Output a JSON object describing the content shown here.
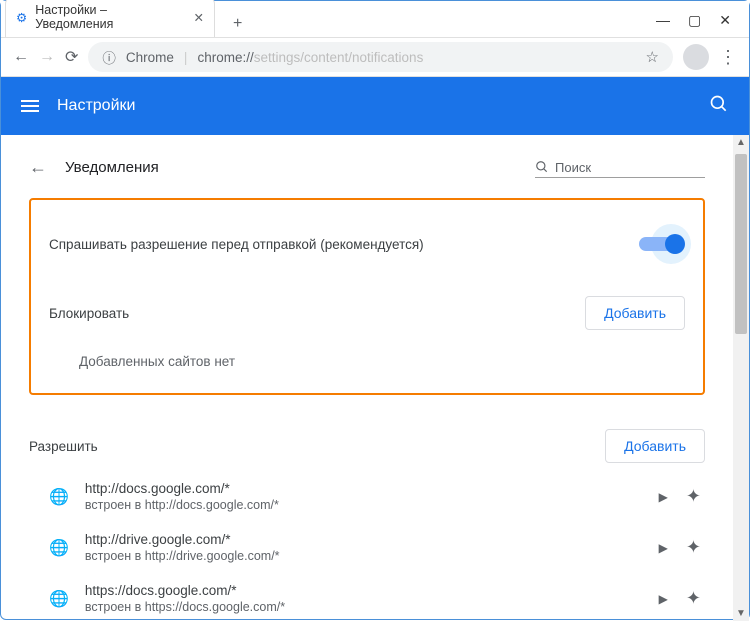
{
  "window": {
    "tab_title": "Настройки – Уведомления"
  },
  "toolbar": {
    "chrome_label": "Chrome",
    "url_host": "chrome://",
    "url_path": "settings/content/notifications"
  },
  "header": {
    "title": "Настройки"
  },
  "page": {
    "title": "Уведомления",
    "search_placeholder": "Поиск"
  },
  "toggle": {
    "label": "Спрашивать разрешение перед отправкой (рекомендуется)"
  },
  "block_section": {
    "label": "Блокировать",
    "add": "Добавить",
    "empty_text": "Добавленных сайтов нет"
  },
  "allow_section": {
    "label": "Разрешить",
    "add": "Добавить",
    "items": [
      {
        "url": "http://docs.google.com/*",
        "embed": "встроен в http://docs.google.com/*"
      },
      {
        "url": "http://drive.google.com/*",
        "embed": "встроен в http://drive.google.com/*"
      },
      {
        "url": "https://docs.google.com/*",
        "embed": "встроен в https://docs.google.com/*"
      }
    ]
  }
}
